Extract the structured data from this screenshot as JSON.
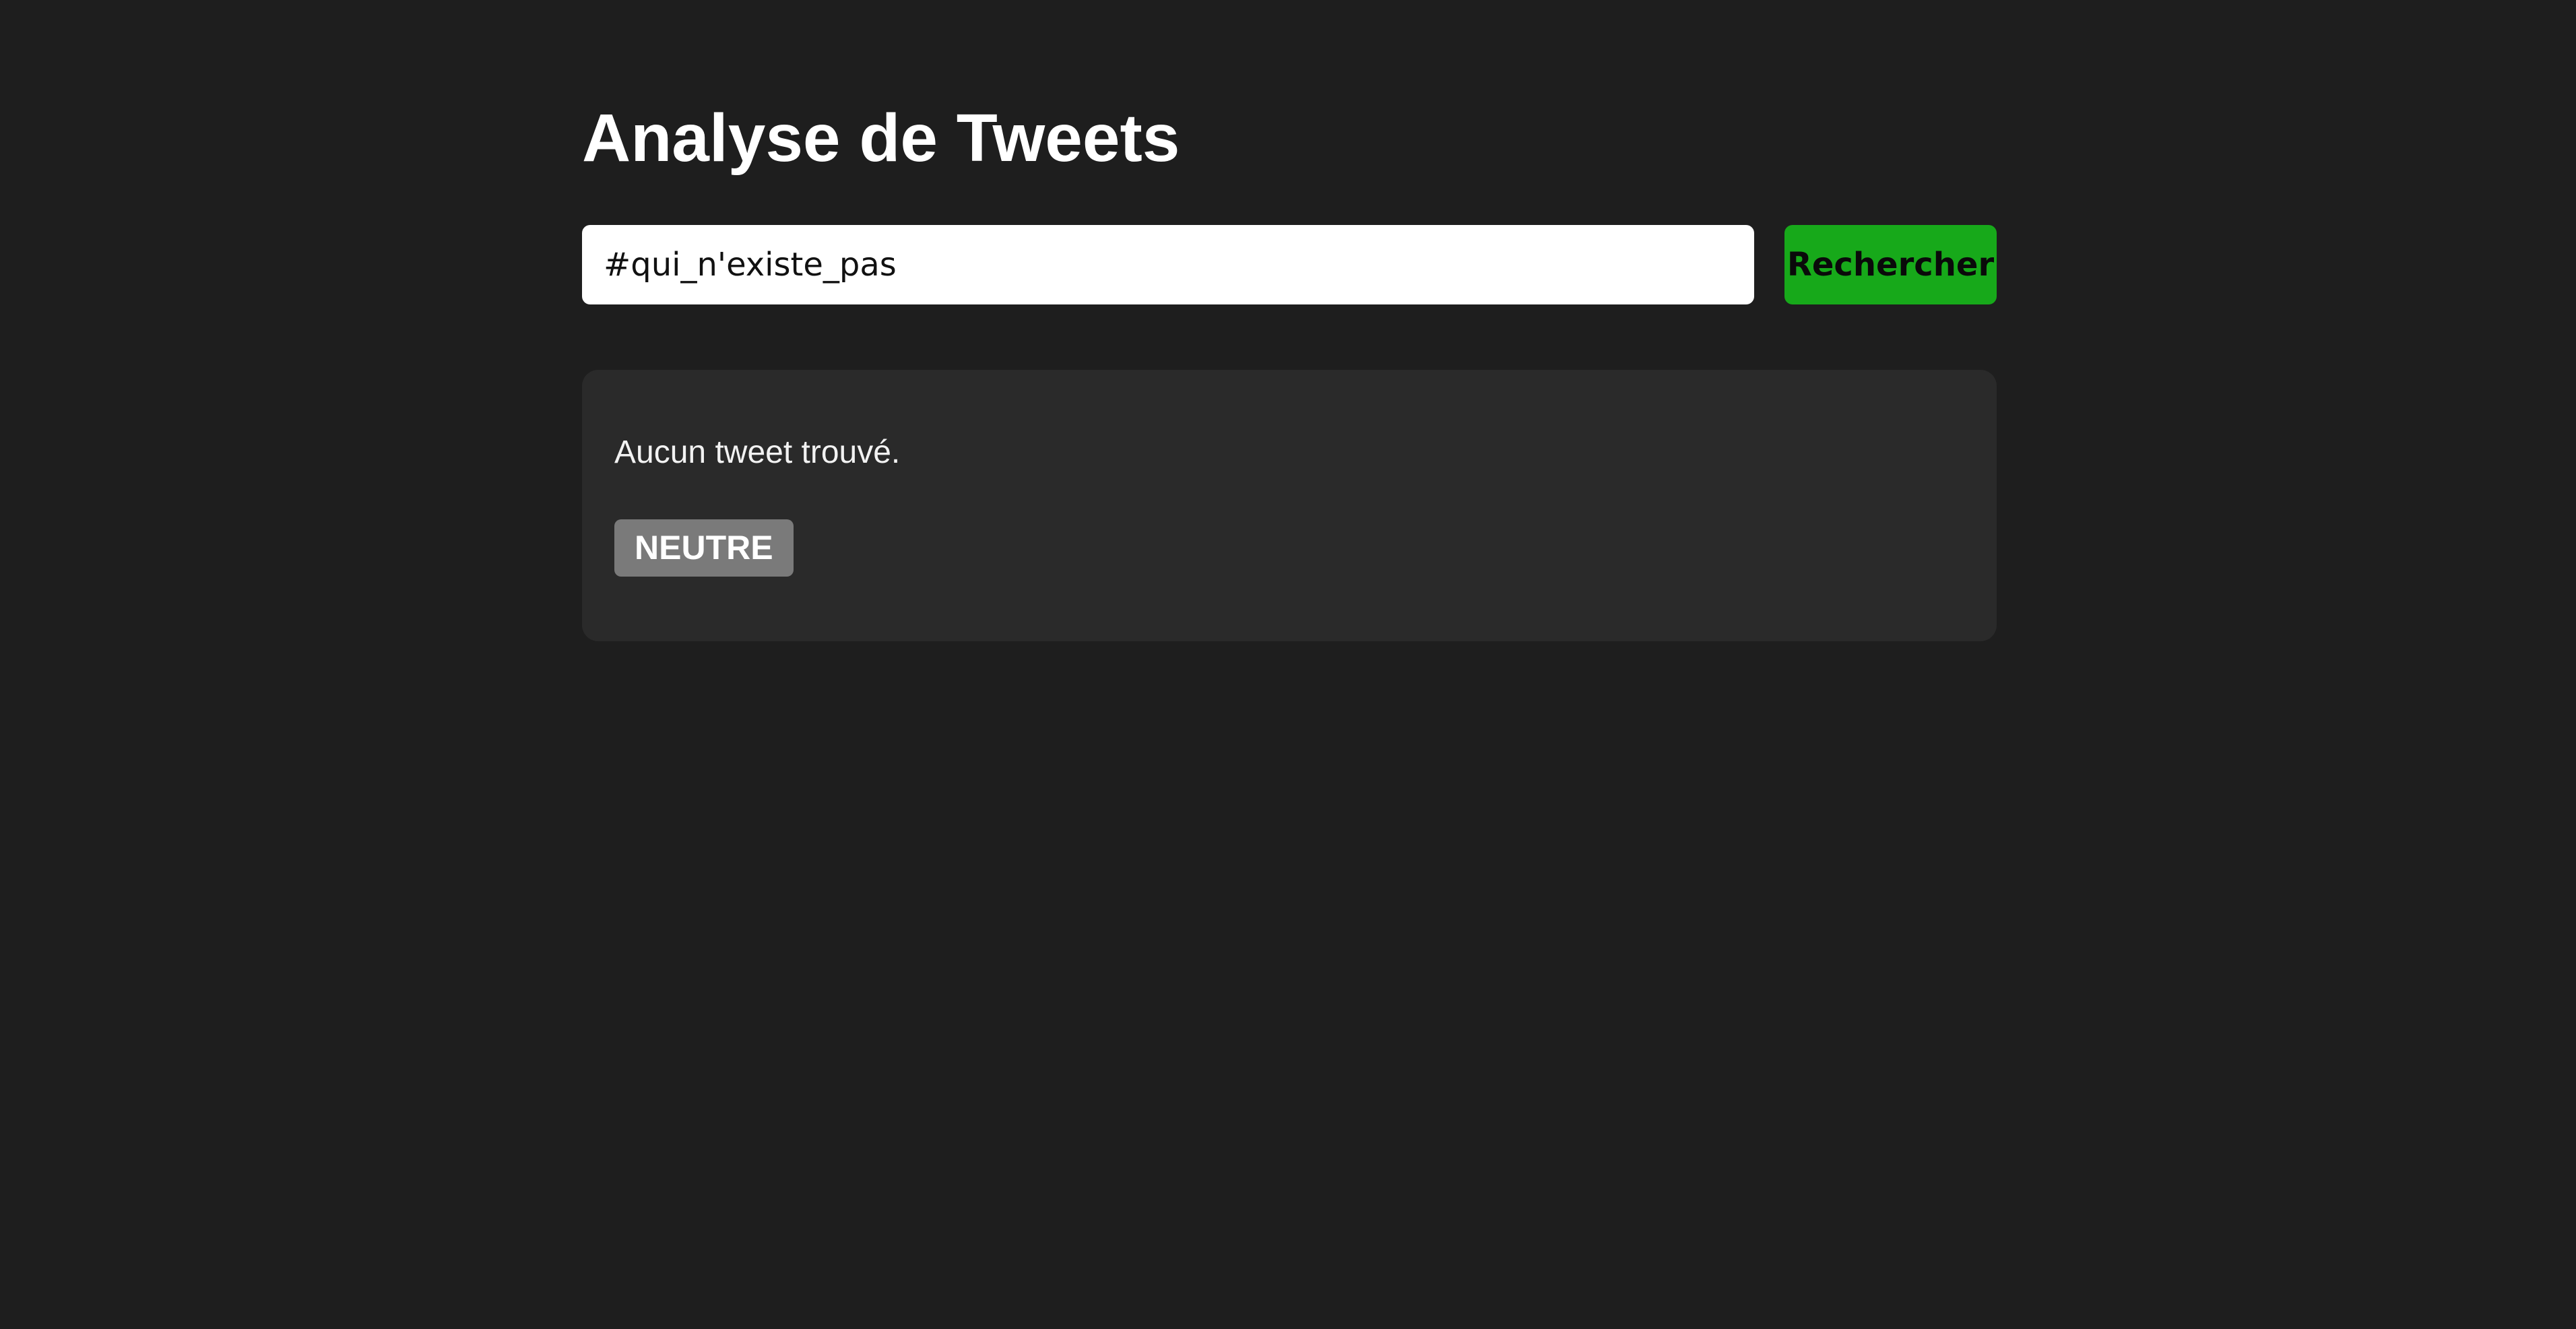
{
  "header": {
    "title": "Analyse de Tweets"
  },
  "search": {
    "value": "#qui_n'existe_pas",
    "button_label": "Rechercher"
  },
  "results": {
    "message": "Aucun tweet trouvé.",
    "sentiment_label": "NEUTRE"
  },
  "colors": {
    "background": "#1e1e1e",
    "card": "#2a2a2a",
    "button": "#17a91a",
    "badge": "#7a7a7a"
  }
}
